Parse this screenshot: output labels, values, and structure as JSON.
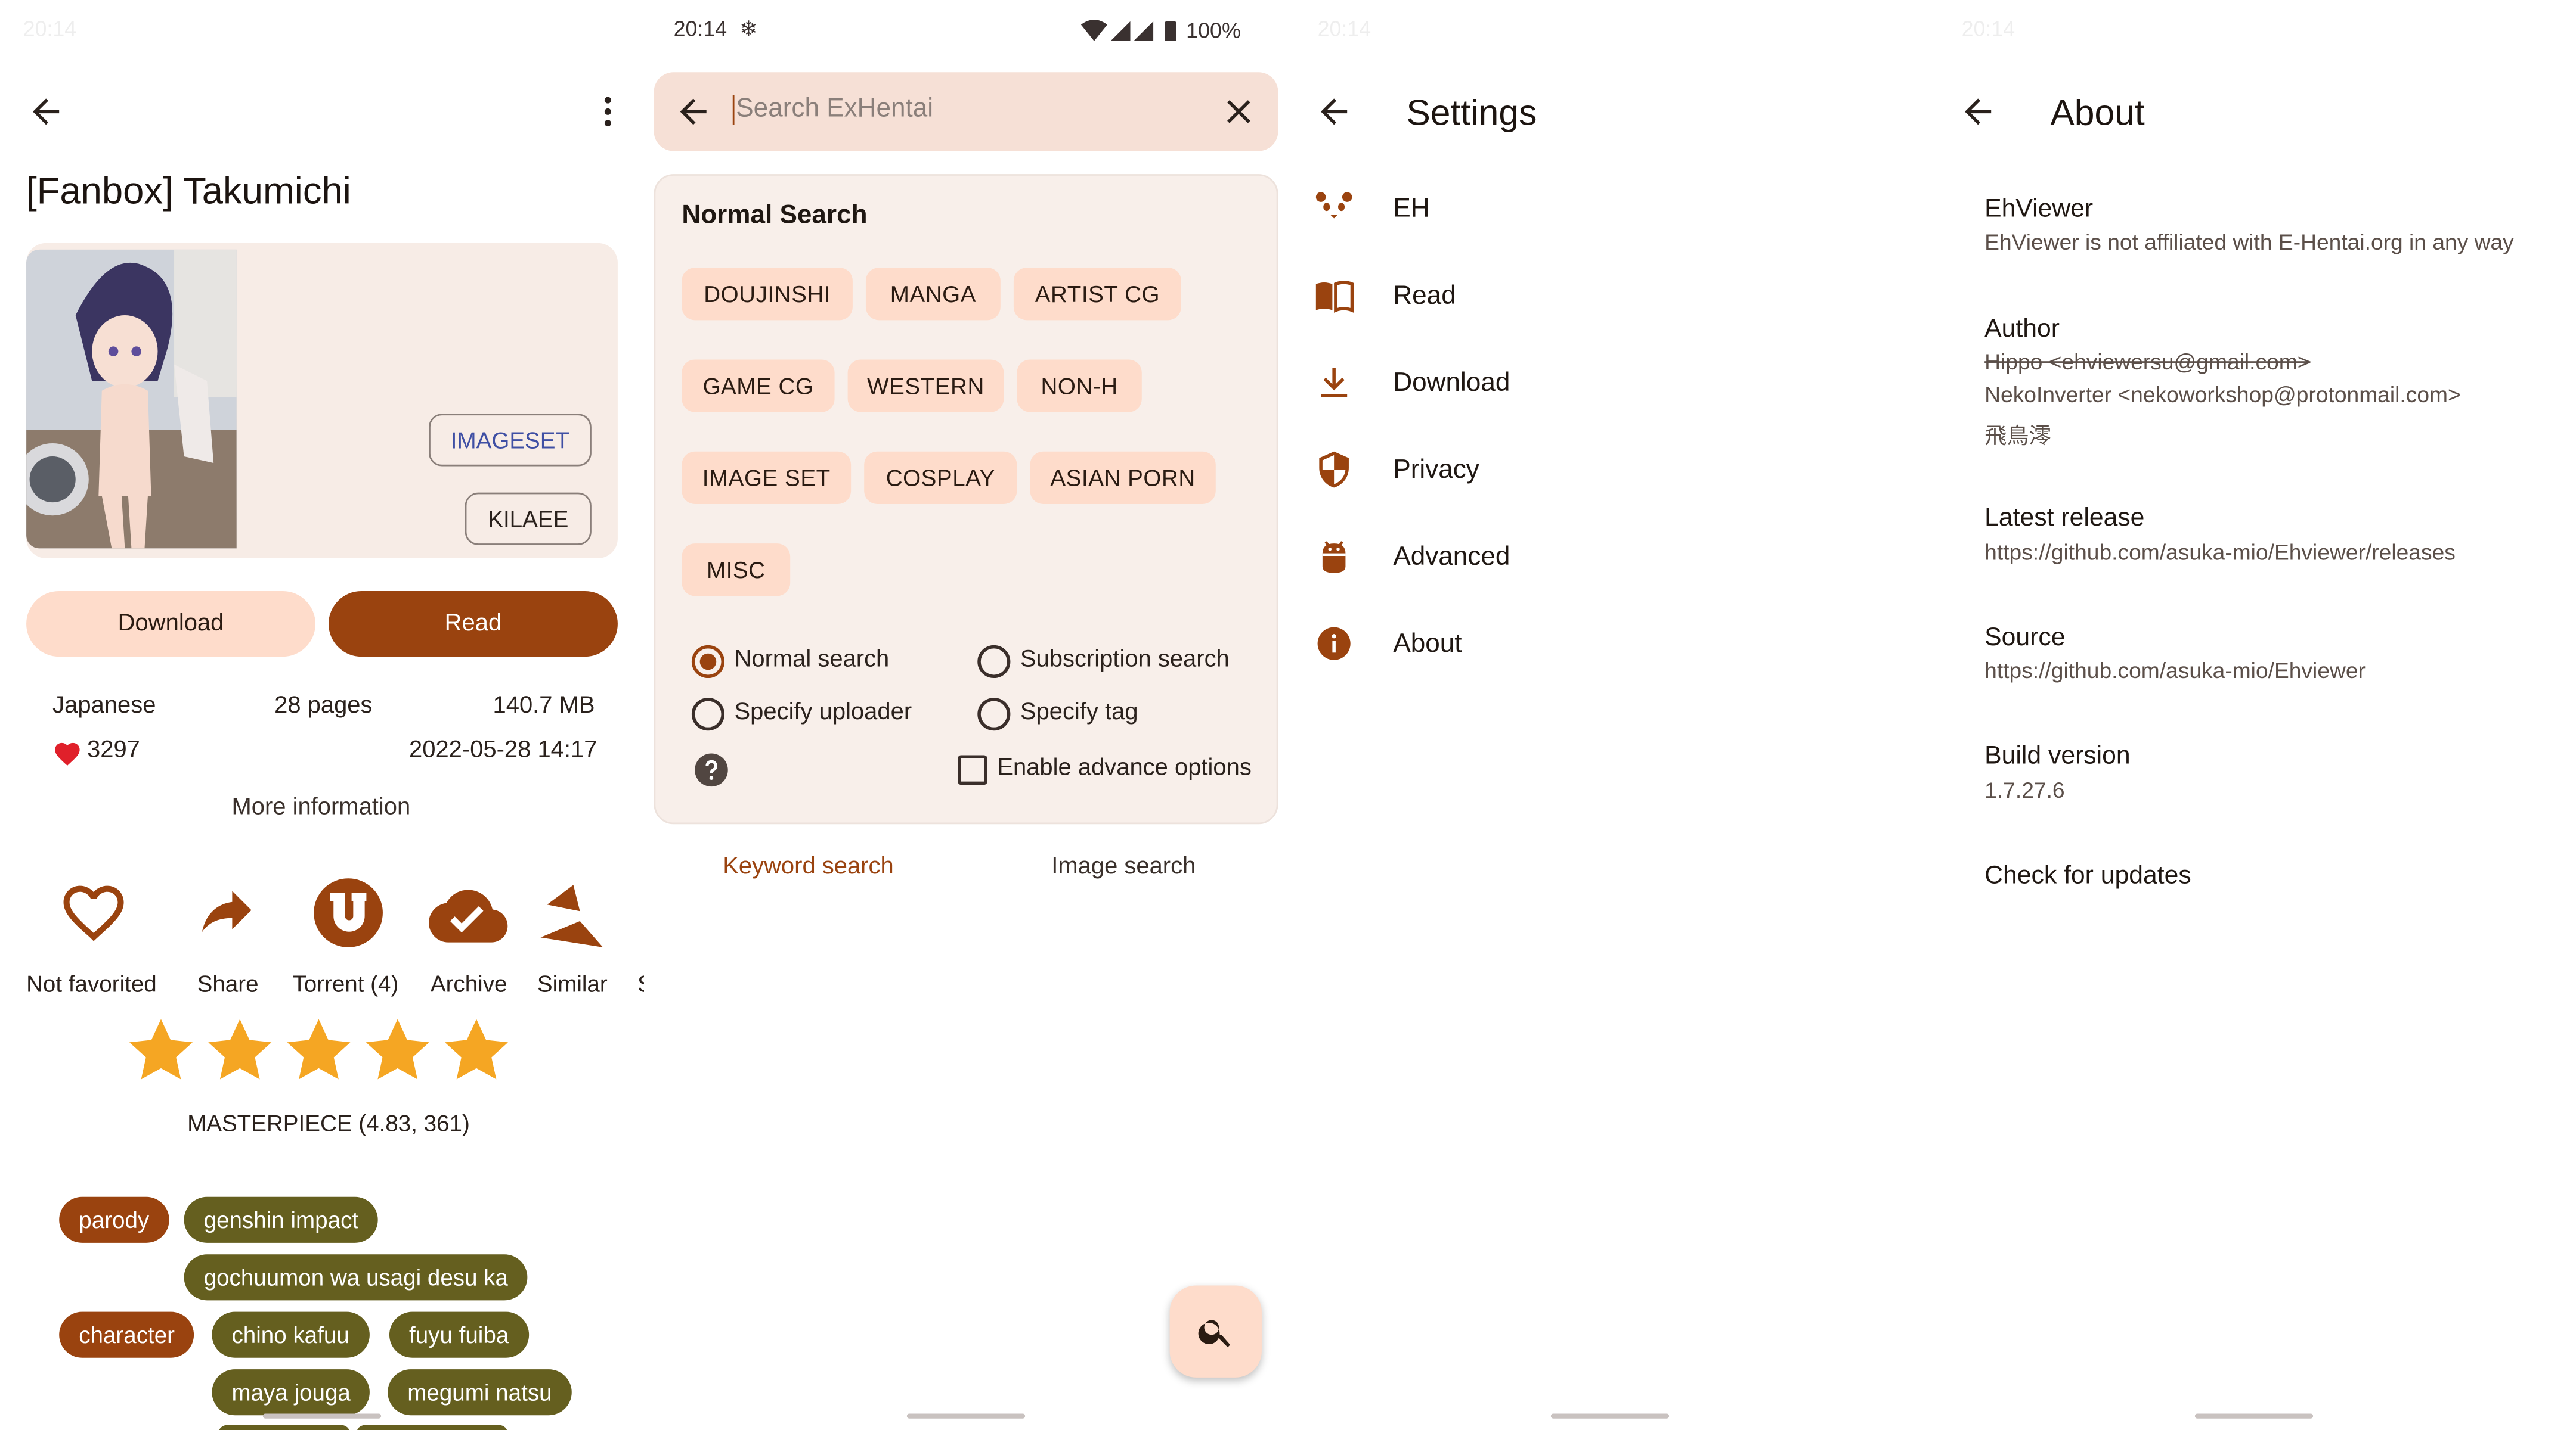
{
  "status_bar": {
    "time": "20:14",
    "battery": "100%"
  },
  "gallery": {
    "title": "[Fanbox] Takumichi",
    "category_label": "IMAGESET",
    "uploader": "KILAEE",
    "download_label": "Download",
    "read_label": "Read",
    "language": "Japanese",
    "pages": "28 pages",
    "size": "140.7 MB",
    "favorites": "3297",
    "posted": "2022-05-28 14:17",
    "more_info": "More information",
    "actions": [
      {
        "label": "Not favorited",
        "icon": "heart-outline-icon"
      },
      {
        "label": "Share",
        "icon": "share-arrow-icon"
      },
      {
        "label": "Torrent (4)",
        "icon": "torrent-icon"
      },
      {
        "label": "Archive",
        "icon": "cloud-check-icon"
      },
      {
        "label": "Similar",
        "icon": "similar-icon"
      },
      {
        "label": "S",
        "icon": ""
      }
    ],
    "rating_stars": 5,
    "rating_text": "MASTERPIECE (4.83, 361)",
    "tags": {
      "parody_ns": "parody",
      "parody": [
        "genshin impact",
        "gochuumon wa usagi desu ka"
      ],
      "character_ns": "character",
      "character": [
        "chino kafuu",
        "fuyu fuiba",
        "maya jouga",
        "megumi natsu"
      ]
    }
  },
  "search": {
    "placeholder": "Search ExHentai",
    "section_title": "Normal Search",
    "categories": [
      "DOUJINSHI",
      "MANGA",
      "ARTIST CG",
      "GAME CG",
      "WESTERN",
      "NON-H",
      "IMAGE SET",
      "COSPLAY",
      "ASIAN PORN",
      "MISC"
    ],
    "modes": {
      "normal": "Normal search",
      "subscription": "Subscription search",
      "uploader": "Specify uploader",
      "tag": "Specify tag"
    },
    "selected_mode": "Normal search",
    "advance_label": "Enable advance options",
    "advance_checked": false,
    "tabs": {
      "keyword": "Keyword search",
      "image": "Image search"
    },
    "active_tab": "Keyword search"
  },
  "settings": {
    "title": "Settings",
    "items": [
      {
        "label": "EH",
        "icon": "panda-icon"
      },
      {
        "label": "Read",
        "icon": "book-icon"
      },
      {
        "label": "Download",
        "icon": "download-icon"
      },
      {
        "label": "Privacy",
        "icon": "shield-icon"
      },
      {
        "label": "Advanced",
        "icon": "android-icon"
      },
      {
        "label": "About",
        "icon": "info-icon"
      }
    ]
  },
  "about": {
    "title": "About",
    "app_name": "EhViewer",
    "disclaimer": "EhViewer is not affiliated with E-Hentai.org in any way",
    "author_title": "Author",
    "authors": [
      "Hippo <ehviewersu@gmail.com>",
      "NekoInverter <nekoworkshop@protonmail.com>",
      "飛鳥澪"
    ],
    "latest_title": "Latest release",
    "latest_url": "https://github.com/asuka-mio/Ehviewer/releases",
    "source_title": "Source",
    "source_url": "https://github.com/asuka-mio/Ehviewer",
    "build_title": "Build version",
    "build_version": "1.7.27.6",
    "check_updates": "Check for updates"
  },
  "colors": {
    "accent": "#9a430f",
    "chip": "#fedccb",
    "tag_olive": "#655f1f",
    "star": "#f5a623",
    "heart": "#e0202a"
  }
}
